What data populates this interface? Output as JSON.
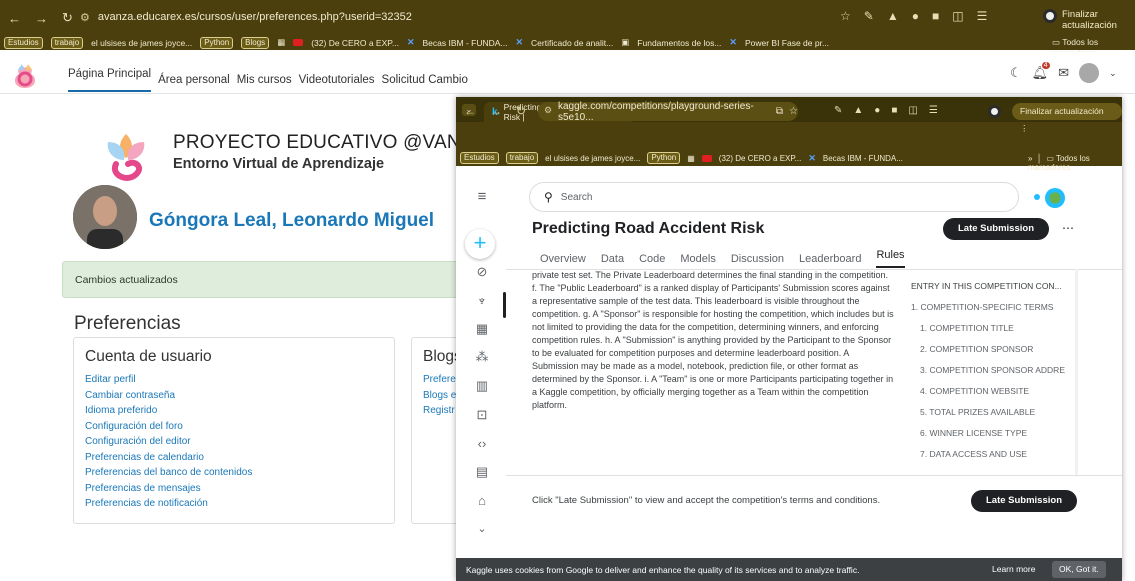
{
  "back_browser": {
    "url": "avanza.educarex.es/cursos/user/preferences.php?userid=32352",
    "update_label": "Finalizar actualización",
    "bookmarks": [
      {
        "label": "Estudios",
        "chip": true
      },
      {
        "label": "trabajo",
        "chip": true
      },
      {
        "label": "el ulsises de james joyce...",
        "chip": false
      },
      {
        "label": "Python",
        "chip": true
      },
      {
        "label": "Blogs",
        "chip": true
      },
      {
        "label": "(32) De CERO a EXP...",
        "chip": false
      },
      {
        "label": "Becas IBM - FUNDA...",
        "chip": false
      },
      {
        "label": "Certificado de analit...",
        "chip": false
      },
      {
        "label": "Fundamentos de los...",
        "chip": false
      },
      {
        "label": "Power BI Fase de pr...",
        "chip": false
      }
    ],
    "all_bookmarks": "Todos los marcadores"
  },
  "moodle": {
    "menu": [
      "Página Principal",
      "Área personal",
      "Mis cursos",
      "Videotutoriales",
      "Solicitud Cambio"
    ],
    "notification_count": "4",
    "project_title": "PROYECTO EDUCATIVO @VANZA",
    "project_subtitle": "Entorno Virtual de Aprendizaje",
    "user_name": "Góngora Leal, Leonardo Miguel",
    "notice": "Cambios actualizados",
    "preferences_title": "Preferencias",
    "account_card": {
      "title": "Cuenta de usuario",
      "links": [
        "Editar perfil",
        "Cambiar contraseña",
        "Idioma preferido",
        "Configuración del foro",
        "Configuración del editor",
        "Preferencias de calendario",
        "Preferencias del banco de contenidos",
        "Preferencias de mensajes",
        "Preferencias de notificación"
      ]
    },
    "blogs_card": {
      "title": "Blogs",
      "links": [
        "Prefere",
        "Blogs e",
        "Registr"
      ]
    }
  },
  "front_browser": {
    "tab_title": "Predicting Road Accident Risk |",
    "url": "kaggle.com/competitions/playground-series-s5e10...",
    "update_label": "Finalizar actualización",
    "bookmarks": [
      {
        "label": "Estudios",
        "chip": true
      },
      {
        "label": "trabajo",
        "chip": true
      },
      {
        "label": "el ulsises de james joyce...",
        "chip": false
      },
      {
        "label": "Python",
        "chip": true
      },
      {
        "label": "(32) De CERO a EXP...",
        "chip": false
      },
      {
        "label": "Becas IBM - FUNDA...",
        "chip": false
      }
    ],
    "all_bookmarks": "Todos los marcadores"
  },
  "kaggle": {
    "search_placeholder": "Search",
    "competition_title": "Predicting Road Accident Risk",
    "late_submission_label": "Late Submission",
    "tabs": [
      "Overview",
      "Data",
      "Code",
      "Models",
      "Discussion",
      "Leaderboard",
      "Rules"
    ],
    "active_tab": "Rules",
    "rules_text": "private test set. The Private Leaderboard determines the final standing in the competition. f. The \"Public Leaderboard\" is a ranked display of Participants' Submission scores against a representative sample of the test data. This leaderboard is visible throughout the competition. g. A \"Sponsor\" is responsible for hosting the competition, which includes but is not limited to providing the data for the competition, determining winners, and enforcing competition rules. h. A \"Submission\" is anything provided by the Participant to the Sponsor to be evaluated for competition purposes and determine leaderboard position. A Submission may be made as a model, notebook, prediction file, or other format as determined by the Sponsor. i. A \"Team\" is one or more Participants participating together in a Kaggle competition, by officially merging together as a Team within the competition platform.",
    "toc": [
      {
        "label": "ENTRY IN THIS COMPETITION CON...",
        "level": 0
      },
      {
        "label": "1. COMPETITION-SPECIFIC TERMS",
        "level": 0
      },
      {
        "label": "1. COMPETITION TITLE",
        "level": 1
      },
      {
        "label": "2. COMPETITION SPONSOR",
        "level": 1
      },
      {
        "label": "3. COMPETITION SPONSOR ADDRE",
        "level": 1
      },
      {
        "label": "4. COMPETITION WEBSITE",
        "level": 1
      },
      {
        "label": "5. TOTAL PRIZES AVAILABLE",
        "level": 1
      },
      {
        "label": "6. WINNER LICENSE TYPE",
        "level": 1
      },
      {
        "label": "7. DATA ACCESS AND USE",
        "level": 1
      }
    ],
    "footer_text": "Click \"Late Submission\" to view and accept the competition's terms and conditions.",
    "cookie_text": "Kaggle uses cookies from Google to deliver and enhance the quality of its services and to analyze traffic.",
    "cookie_learn_more": "Learn more",
    "cookie_ok": "OK, Got it."
  },
  "colors": {
    "browser_frame": "#4a3f0d",
    "moodle_link": "#1b78b8",
    "kaggle_blue": "#20beff",
    "kaggle_dark": "#202124"
  }
}
